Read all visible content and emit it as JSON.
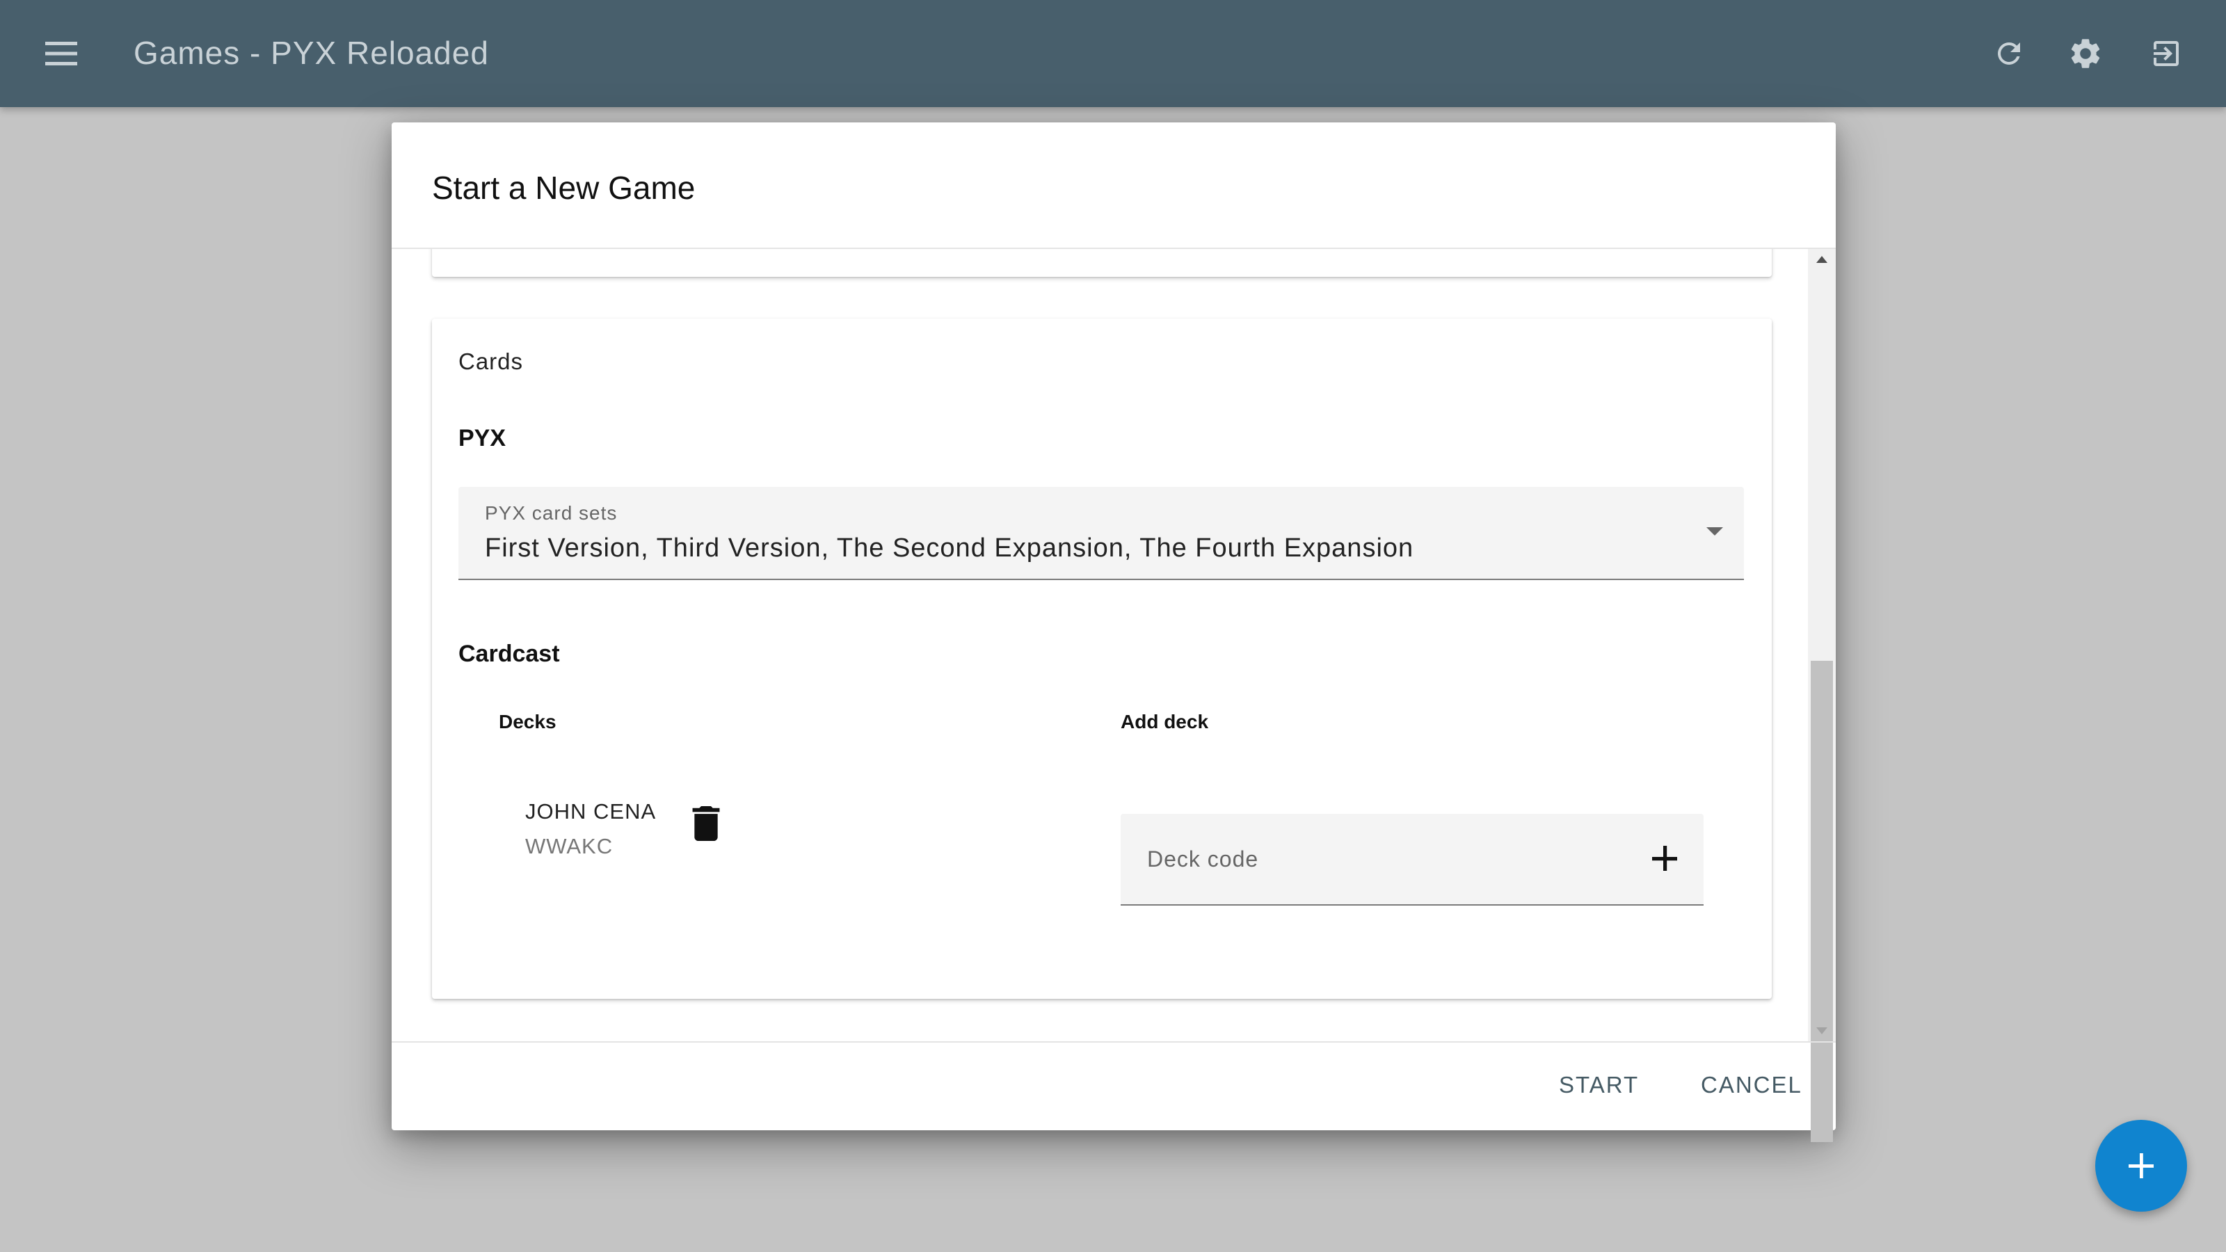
{
  "app_bar": {
    "title": "Games - PYX Reloaded",
    "background_color": "#485f6c",
    "menu_icon": "menu-icon",
    "actions": [
      {
        "icon": "refresh-icon"
      },
      {
        "icon": "gear-icon"
      },
      {
        "icon": "logout-icon"
      }
    ]
  },
  "dialog": {
    "title": "Start a New Game",
    "cards_section": {
      "heading": "Cards",
      "pyx": {
        "heading": "PYX",
        "card_sets_label": "PYX card sets",
        "card_sets_value": "First Version, Third Version, The Second Expansion, The Fourth Expansion"
      },
      "cardcast": {
        "heading": "Cardcast",
        "decks_heading": "Decks",
        "add_deck_heading": "Add deck",
        "decks": [
          {
            "name": "JOHN CENA",
            "code": "WWAKC"
          }
        ],
        "deck_code_placeholder": "Deck code",
        "deck_code_value": ""
      }
    },
    "actions": {
      "start_label": "START",
      "cancel_label": "CANCEL"
    }
  },
  "fab": {
    "icon": "plus-icon",
    "color": "#1084cf"
  }
}
